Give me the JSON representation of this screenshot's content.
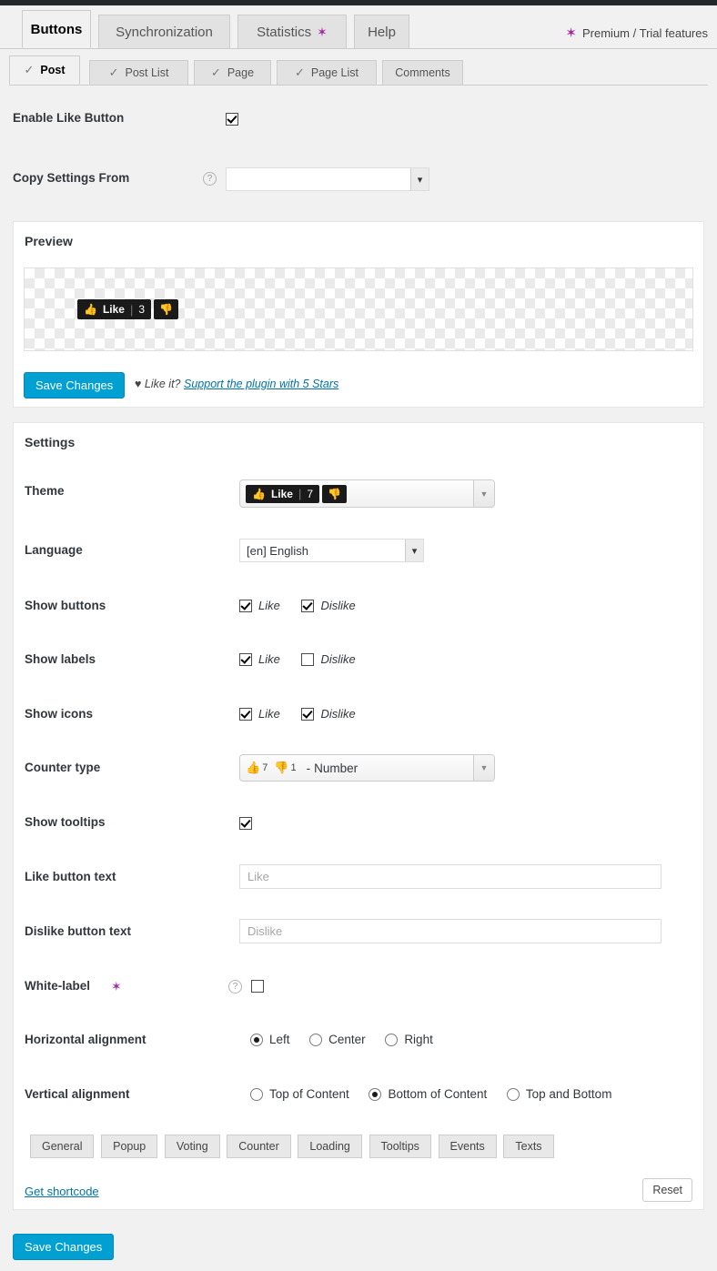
{
  "theme_colors": {
    "accent": "#00a0d2",
    "link": "#0073aa",
    "premium_star": "#a626a6",
    "admin_bar": "#23282d"
  },
  "main_tabs": [
    {
      "label": "Buttons",
      "active": true,
      "star": false
    },
    {
      "label": "Synchronization",
      "active": false,
      "star": false
    },
    {
      "label": "Statistics",
      "active": false,
      "star": true
    },
    {
      "label": "Help",
      "active": false,
      "star": false
    }
  ],
  "premium_notice": {
    "star": "✶",
    "label": "Premium / Trial features"
  },
  "sub_tabs": [
    {
      "label": "Post",
      "active": true,
      "check": "✓"
    },
    {
      "label": "Post List",
      "active": false,
      "check": "✓"
    },
    {
      "label": "Page",
      "active": false,
      "check": "✓"
    },
    {
      "label": "Page List",
      "active": false,
      "check": "✓"
    },
    {
      "label": "Comments",
      "active": false,
      "check": ""
    }
  ],
  "top_fields": {
    "enable_like_button": {
      "label": "Enable Like Button",
      "checked": true
    },
    "copy_settings_from": {
      "label": "Copy Settings From",
      "value": "",
      "help": "?"
    }
  },
  "preview": {
    "title": "Preview",
    "widget": {
      "icon_like": "👍",
      "label": "Like",
      "separator": "|",
      "count": "3",
      "icon_dislike": "👎"
    },
    "save_label": "Save Changes",
    "like_it_prefix": "♥ Like it?",
    "support_link": "Support the plugin with 5 Stars"
  },
  "settings": {
    "title": "Settings",
    "theme": {
      "label": "Theme",
      "widget": {
        "icon_like": "👍",
        "label": "Like",
        "separator": "|",
        "count": "7",
        "icon_dislike": "👎"
      }
    },
    "language": {
      "label": "Language",
      "value": "[en] English"
    },
    "show_buttons": {
      "label": "Show buttons",
      "options": [
        {
          "label": "Like",
          "checked": true
        },
        {
          "label": "Dislike",
          "checked": true
        }
      ]
    },
    "show_labels": {
      "label": "Show labels",
      "options": [
        {
          "label": "Like",
          "checked": true
        },
        {
          "label": "Dislike",
          "checked": false
        }
      ]
    },
    "show_icons": {
      "label": "Show icons",
      "options": [
        {
          "label": "Like",
          "checked": true
        },
        {
          "label": "Dislike",
          "checked": true
        }
      ]
    },
    "counter_type": {
      "label": "Counter type",
      "icon_like": "👍",
      "count_like": "7",
      "icon_dislike": "👎",
      "count_dislike": "1",
      "dash": "-",
      "value": "Number"
    },
    "show_tooltips": {
      "label": "Show tooltips",
      "checked": true
    },
    "like_button_text": {
      "label": "Like button text",
      "value": "",
      "placeholder": "Like"
    },
    "dislike_button_text": {
      "label": "Dislike button text",
      "value": "",
      "placeholder": "Dislike"
    },
    "white_label": {
      "label": "White-label",
      "star": "✶",
      "help": "?",
      "checked": false
    },
    "horizontal_alignment": {
      "label": "Horizontal alignment",
      "options": [
        {
          "label": "Left",
          "checked": true
        },
        {
          "label": "Center",
          "checked": false
        },
        {
          "label": "Right",
          "checked": false
        }
      ]
    },
    "vertical_alignment": {
      "label": "Vertical alignment",
      "options": [
        {
          "label": "Top of Content",
          "checked": false
        },
        {
          "label": "Bottom of Content",
          "checked": true
        },
        {
          "label": "Top and Bottom",
          "checked": false
        }
      ]
    },
    "section_tabs": [
      {
        "label": "General"
      },
      {
        "label": "Popup"
      },
      {
        "label": "Voting"
      },
      {
        "label": "Counter"
      },
      {
        "label": "Loading"
      },
      {
        "label": "Tooltips"
      },
      {
        "label": "Events"
      },
      {
        "label": "Texts"
      }
    ],
    "get_shortcode_label": "Get shortcode",
    "reset_label": "Reset"
  },
  "footer": {
    "save_label": "Save Changes"
  }
}
